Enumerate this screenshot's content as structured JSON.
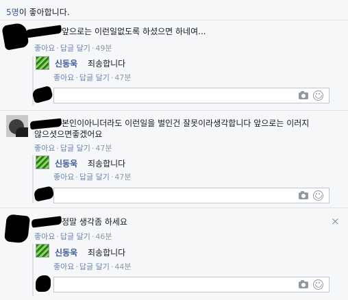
{
  "likes": {
    "count": "5명",
    "suffix": "이 좋아합니다."
  },
  "actions": {
    "like": "좋아요",
    "reply": "답글 달기",
    "separator": "·"
  },
  "comments": [
    {
      "text": "앞으로는 이런일없도록 하셨으면 하네여...",
      "time": "49분",
      "reply": {
        "name": "신동욱",
        "text": "죄송합니다",
        "time": "47분"
      }
    },
    {
      "text_line1": "본인이아니더라도 이런일을 벌인건 잘못이라생각합니다 앞으로는 이러지",
      "text_line2": "않으셧으면좋겠어요",
      "time": "47분",
      "reply": {
        "name": "신동욱",
        "text": "죄송합니다",
        "time": "47분"
      }
    },
    {
      "text": "정말 생각좀 하세요",
      "time": "46분",
      "reply": {
        "name": "신동욱",
        "text": "죄송합니다",
        "time": "44분"
      }
    }
  ],
  "close_glyph": "×",
  "icons": [
    "camera-icon",
    "emoji-icon",
    "close-icon"
  ]
}
